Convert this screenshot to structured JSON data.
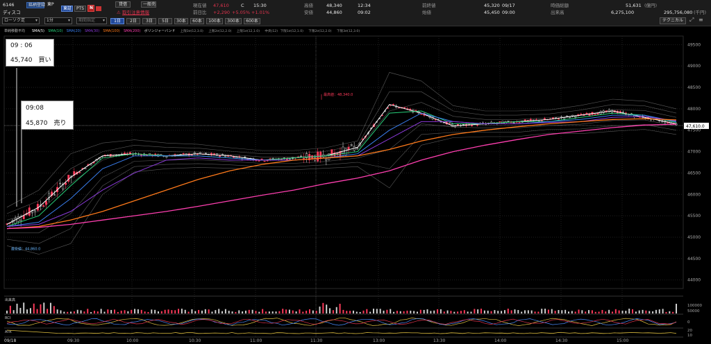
{
  "header": {
    "code": "6146",
    "name": "ディスコ",
    "buttons": [
      "銘柄登録",
      "東P"
    ],
    "market_tabs": [
      "東証",
      "PTS"
    ],
    "n_icon": "N",
    "credit_tab": "貸借",
    "general_tab": "一般売",
    "warning_text": "取引注意情報",
    "price_label": "現在値",
    "price": "47,610",
    "price_flag": "C",
    "price_time": "15:30",
    "prevday_label": "前日比",
    "change": "+2,290",
    "change_pct": "+5.05%",
    "change_pct2": "+1.01%",
    "high_label": "高値",
    "high": "48,340",
    "high_time": "12:34",
    "low_label": "安値",
    "low": "44,860",
    "low_time": "09:02",
    "prev_close_label": "前終値",
    "prev_close": "45,320",
    "prev_close_date": "09/17",
    "open_label": "始値",
    "open": "45,450",
    "open_time": "09:00",
    "market_cap_label": "時価総額",
    "market_cap": "51,631",
    "market_cap_unit": "(億円)",
    "volume_label": "出来高",
    "volume": "6,275,100",
    "turnover": "295,756,080",
    "turnover_unit": "(千円)",
    "chart_type": "ローソク足",
    "interval": "1分",
    "period_placeholder": "期間指定",
    "period_buttons": [
      "1日",
      "2日",
      "3日",
      "5日",
      "30本",
      "60本",
      "100本",
      "300本",
      "600本"
    ],
    "technical_button": "テクニカル"
  },
  "indicator_bar": {
    "title": "単純移動平均",
    "items": [
      {
        "label": "SMA(5)",
        "color": "#ffffff"
      },
      {
        "label": "SMA(10)",
        "color": "#27d07a"
      },
      {
        "label": "SMA(20)",
        "color": "#3a7ff0"
      },
      {
        "label": "SMA(30)",
        "color": "#8a3ad8"
      },
      {
        "label": "SMA(100)",
        "color": "#ff7a1a"
      },
      {
        "label": "SMA(200)",
        "color": "#ff3fb0"
      }
    ],
    "bollinger": "ボリンジャーバンド",
    "bands": [
      "上限3σ(12,3.0)",
      "上限2σ(12,2.0)",
      "上限1σ(12,1.0)",
      "中央(12)",
      "下限1σ(12,1.0)",
      "下限2σ(12,2.0)",
      "下限3σ(12,3.0)"
    ]
  },
  "annotations": {
    "buy": {
      "time": "09 : 06",
      "price_action": "45,740　買い"
    },
    "sell": {
      "time": "09:08",
      "price_action": "45,870　売り"
    },
    "max_label": "最高値：48,340.0",
    "min_label": "最安値：44,860.0",
    "current_tag": "47,610.0"
  },
  "volume_panel": {
    "label": "出来高",
    "ticks": [
      "100000",
      "50000"
    ]
  },
  "rsi_panel": {
    "label": "RCI",
    "ticks": [
      "0"
    ]
  },
  "atr_panel": {
    "label": "ATR",
    "ticks": [
      "20",
      "10"
    ]
  },
  "colors": {
    "up": "#ff3a5a",
    "down": "#cfcfcf",
    "sma5": "#ffffff",
    "sma10": "#27d07a",
    "sma20": "#3a7ff0",
    "sma30": "#8a3ad8",
    "sma100": "#ff7a1a",
    "sma200": "#ff3fb0"
  },
  "chart_data": {
    "type": "candlestick",
    "date_label": "09/18",
    "x_ticks": [
      "09:30",
      "10:00",
      "10:30",
      "11:00",
      "11:30",
      "13:00",
      "13:30",
      "14:00",
      "14:30",
      "15:00"
    ],
    "y_ticks": [
      49500,
      49000,
      48500,
      48000,
      47500,
      47000,
      46500,
      46000,
      45500,
      45000,
      44500,
      44000
    ],
    "ylim": [
      43800,
      49700
    ],
    "series": [
      {
        "name": "SMA(5)",
        "values": [
          45300,
          45700,
          46400,
          46900,
          46950,
          46900,
          46950,
          46900,
          46800,
          46850,
          46900,
          47100,
          48100,
          47900,
          47600,
          47650,
          47700,
          47750,
          47850,
          47950,
          47800,
          47650
        ]
      },
      {
        "name": "SMA(10)",
        "values": [
          45250,
          45500,
          46200,
          46850,
          46950,
          46900,
          46900,
          46850,
          46800,
          46850,
          46900,
          47000,
          47900,
          47950,
          47650,
          47650,
          47700,
          47700,
          47800,
          47900,
          47850,
          47680
        ]
      },
      {
        "name": "SMA(20)",
        "values": [
          45250,
          45350,
          45900,
          46600,
          46900,
          46900,
          46900,
          46850,
          46800,
          46800,
          46850,
          46950,
          47500,
          47900,
          47700,
          47650,
          47650,
          47700,
          47750,
          47850,
          47850,
          47700
        ]
      },
      {
        "name": "SMA(30)",
        "values": [
          45250,
          45300,
          45600,
          46100,
          46500,
          46800,
          46850,
          46800,
          46800,
          46800,
          46850,
          46900,
          47300,
          47700,
          47700,
          47650,
          47650,
          47680,
          47700,
          47800,
          47820,
          47720
        ]
      },
      {
        "name": "SMA(100)",
        "values": [
          45200,
          45250,
          45400,
          45600,
          45850,
          46100,
          46350,
          46550,
          46700,
          46800,
          46850,
          46900,
          47050,
          47250,
          47400,
          47500,
          47580,
          47650,
          47700,
          47750,
          47770,
          47740
        ]
      },
      {
        "name": "SMA(200)",
        "values": [
          45200,
          45230,
          45300,
          45400,
          45500,
          45600,
          45720,
          45850,
          45980,
          46100,
          46250,
          46380,
          46550,
          46800,
          47000,
          47150,
          47280,
          47400,
          47480,
          47560,
          47620,
          47640
        ]
      }
    ],
    "high": 48340,
    "low": 44860,
    "last": 47610
  }
}
